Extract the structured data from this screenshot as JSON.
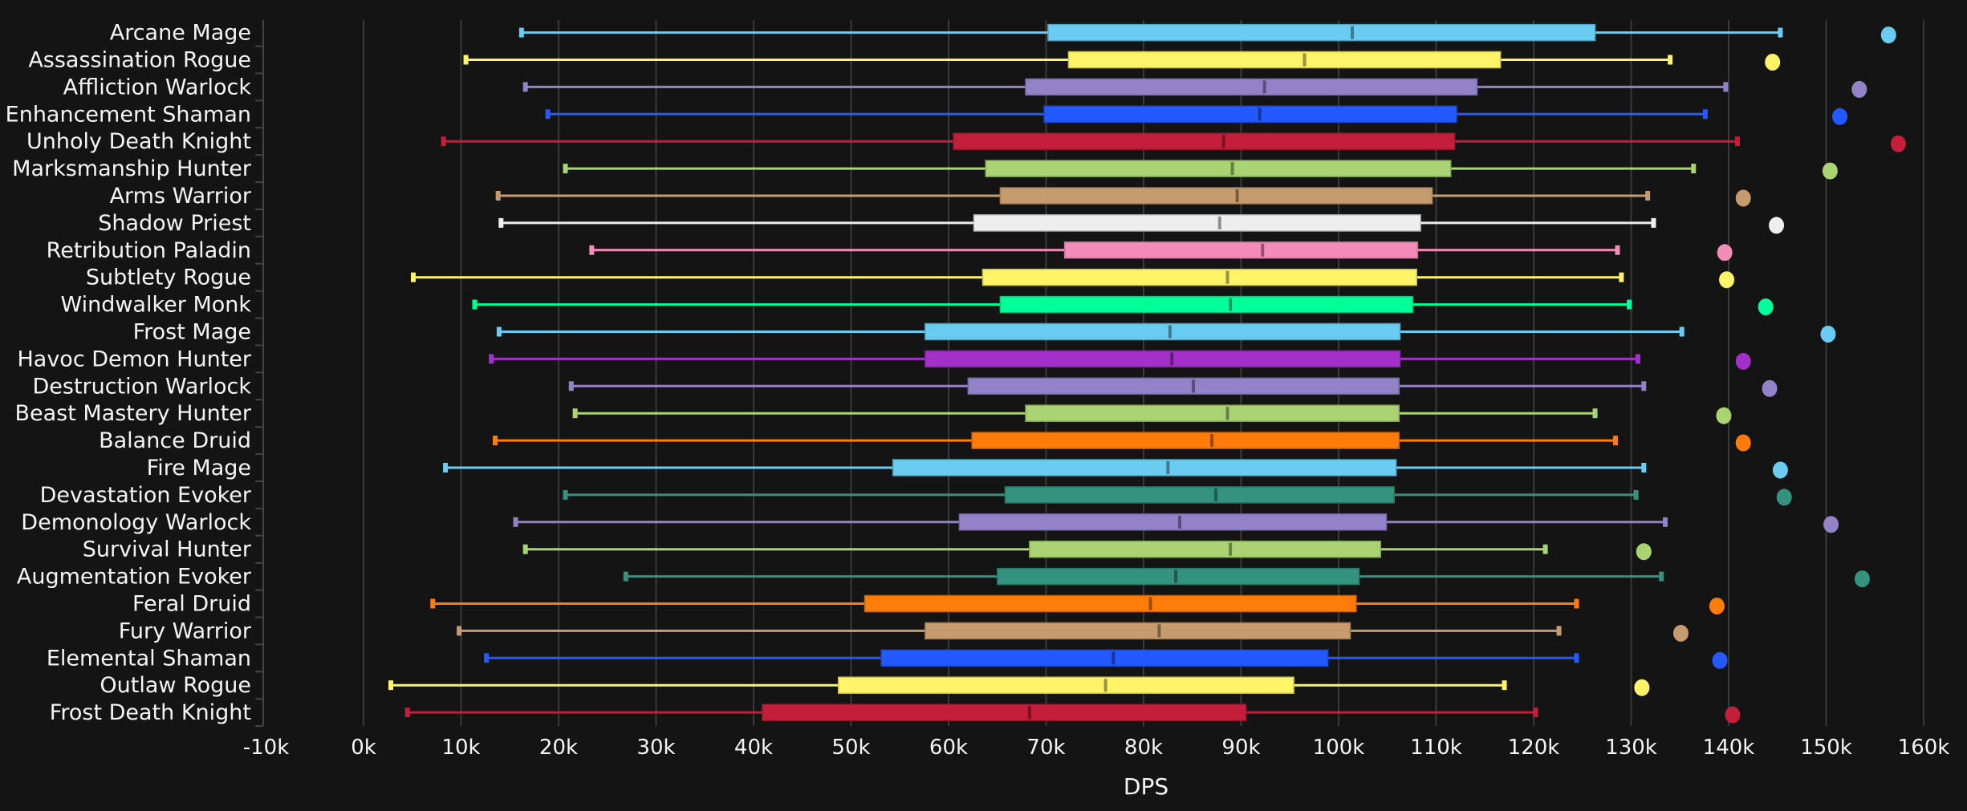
{
  "chart_data": {
    "type": "boxplot",
    "title": "",
    "xlabel": "DPS",
    "ylabel": "",
    "xlim": [
      -10000,
      160000
    ],
    "grid": true,
    "orientation": "horizontal",
    "x_ticks": [
      "-10k",
      "0k",
      "10k",
      "20k",
      "30k",
      "40k",
      "50k",
      "60k",
      "70k",
      "80k",
      "90k",
      "100k",
      "110k",
      "120k",
      "130k",
      "140k",
      "150k",
      "160k"
    ],
    "x_tick_values": [
      -10000,
      0,
      10000,
      20000,
      30000,
      40000,
      50000,
      60000,
      70000,
      80000,
      90000,
      100000,
      110000,
      120000,
      130000,
      140000,
      150000,
      160000
    ],
    "series": [
      {
        "name": "Arcane Mage",
        "color": "#69ccf0",
        "min": 16200,
        "q1": 70200,
        "median": 101400,
        "q3": 126300,
        "max": 145300,
        "outlier": 156400
      },
      {
        "name": "Assassination Rogue",
        "color": "#fff468",
        "min": 10500,
        "q1": 72300,
        "median": 96500,
        "q3": 116600,
        "max": 134000,
        "outlier": 144500
      },
      {
        "name": "Affliction Warlock",
        "color": "#9482c9",
        "min": 16600,
        "q1": 67900,
        "median": 92400,
        "q3": 114200,
        "max": 139700,
        "outlier": 153400
      },
      {
        "name": "Enhancement Shaman",
        "color": "#2459ff",
        "min": 18900,
        "q1": 69800,
        "median": 91900,
        "q3": 112100,
        "max": 137600,
        "outlier": 151400
      },
      {
        "name": "Unholy Death Knight",
        "color": "#c41e3a",
        "min": 8200,
        "q1": 60500,
        "median": 88200,
        "q3": 111900,
        "max": 140900,
        "outlier": 157400
      },
      {
        "name": "Marksmanship Hunter",
        "color": "#aad372",
        "min": 20700,
        "q1": 63800,
        "median": 89100,
        "q3": 111500,
        "max": 136400,
        "outlier": 150400
      },
      {
        "name": "Arms Warrior",
        "color": "#c69b6d",
        "min": 13800,
        "q1": 65300,
        "median": 89600,
        "q3": 109600,
        "max": 131700,
        "outlier": 141500
      },
      {
        "name": "Shadow Priest",
        "color": "#eeeeee",
        "min": 14100,
        "q1": 62600,
        "median": 87800,
        "q3": 108400,
        "max": 132300,
        "outlier": 144900
      },
      {
        "name": "Retribution Paladin",
        "color": "#f48cba",
        "min": 23400,
        "q1": 71900,
        "median": 92200,
        "q3": 108100,
        "max": 128600,
        "outlier": 139600
      },
      {
        "name": "Subtlety Rogue",
        "color": "#fff468",
        "min": 5100,
        "q1": 63500,
        "median": 88600,
        "q3": 108000,
        "max": 129000,
        "outlier": 139800
      },
      {
        "name": "Windwalker Monk",
        "color": "#00ff98",
        "min": 11400,
        "q1": 65300,
        "median": 88900,
        "q3": 107600,
        "max": 129800,
        "outlier": 143800
      },
      {
        "name": "Frost Mage",
        "color": "#69ccf0",
        "min": 13900,
        "q1": 57600,
        "median": 82700,
        "q3": 106300,
        "max": 135200,
        "outlier": 150200
      },
      {
        "name": "Havoc Demon Hunter",
        "color": "#a330c9",
        "min": 13100,
        "q1": 57600,
        "median": 82900,
        "q3": 106300,
        "max": 130700,
        "outlier": 141500
      },
      {
        "name": "Destruction Warlock",
        "color": "#9482c9",
        "min": 21300,
        "q1": 62000,
        "median": 85100,
        "q3": 106200,
        "max": 131300,
        "outlier": 144200
      },
      {
        "name": "Beast Mastery Hunter",
        "color": "#aad372",
        "min": 21700,
        "q1": 67900,
        "median": 88600,
        "q3": 106200,
        "max": 126300,
        "outlier": 139500
      },
      {
        "name": "Balance Druid",
        "color": "#ff7c0a",
        "min": 13500,
        "q1": 62400,
        "median": 87000,
        "q3": 106200,
        "max": 128400,
        "outlier": 141500
      },
      {
        "name": "Fire Mage",
        "color": "#69ccf0",
        "min": 8400,
        "q1": 54300,
        "median": 82500,
        "q3": 105900,
        "max": 131300,
        "outlier": 145300
      },
      {
        "name": "Devastation Evoker",
        "color": "#33937f",
        "min": 20700,
        "q1": 65800,
        "median": 87400,
        "q3": 105700,
        "max": 130500,
        "outlier": 145700
      },
      {
        "name": "Demonology Warlock",
        "color": "#9482c9",
        "min": 15600,
        "q1": 61100,
        "median": 83700,
        "q3": 104900,
        "max": 133500,
        "outlier": 150500
      },
      {
        "name": "Survival Hunter",
        "color": "#aad372",
        "min": 16600,
        "q1": 68300,
        "median": 88900,
        "q3": 104300,
        "max": 121200,
        "outlier": 131300
      },
      {
        "name": "Augmentation Evoker",
        "color": "#33937f",
        "min": 26900,
        "q1": 65000,
        "median": 83300,
        "q3": 102100,
        "max": 133100,
        "outlier": 153700
      },
      {
        "name": "Feral Druid",
        "color": "#ff7c0a",
        "min": 7100,
        "q1": 51400,
        "median": 80700,
        "q3": 101800,
        "max": 124400,
        "outlier": 138800
      },
      {
        "name": "Fury Warrior",
        "color": "#c69b6d",
        "min": 9800,
        "q1": 57600,
        "median": 81600,
        "q3": 101200,
        "max": 122600,
        "outlier": 135100
      },
      {
        "name": "Elemental Shaman",
        "color": "#2459ff",
        "min": 12600,
        "q1": 53100,
        "median": 76900,
        "q3": 98900,
        "max": 124400,
        "outlier": 139100
      },
      {
        "name": "Outlaw Rogue",
        "color": "#fff468",
        "min": 2800,
        "q1": 48700,
        "median": 76100,
        "q3": 95400,
        "max": 117000,
        "outlier": 131100
      },
      {
        "name": "Frost Death Knight",
        "color": "#c41e3a",
        "min": 4500,
        "q1": 40900,
        "median": 68300,
        "q3": 90500,
        "max": 120200,
        "outlier": 140400
      }
    ]
  },
  "colors": {
    "background": "#141414",
    "grid": "#3a3a3a",
    "text": "#f5f5f5"
  }
}
